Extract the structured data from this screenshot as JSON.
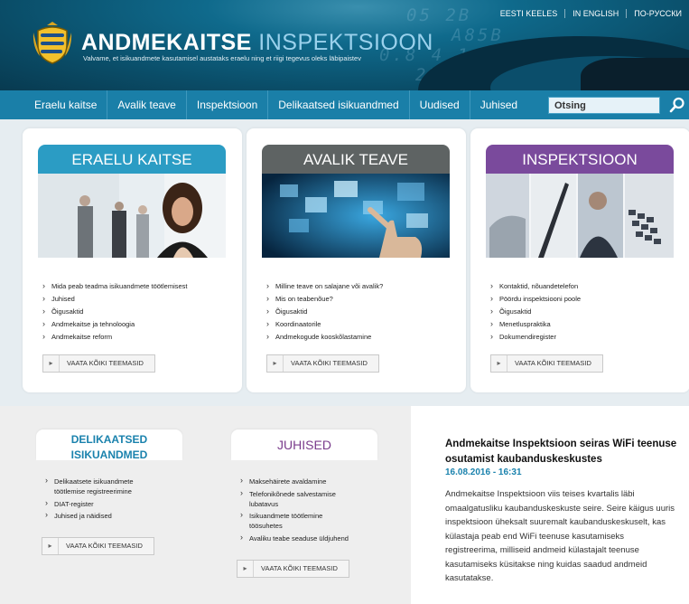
{
  "header": {
    "languages": [
      "EESTI KEELES",
      "IN ENGLISH",
      "ПО-РУССКИ"
    ],
    "brand_part1": "ANDMEKAITSE",
    "brand_part2": "INSPEKTSIOON",
    "tagline": "Valvame, et isikuandmete kasutamisel austataks eraelu ning et riigi tegevus oleks läbipaistev",
    "bg_digits": [
      "05 2B",
      "A85B",
      "0.8 4 1",
      "25BE7"
    ]
  },
  "nav": {
    "items": [
      "Eraelu kaitse",
      "Avalik teave",
      "Inspektsioon",
      "Delikaatsed isikuandmed",
      "Uudised",
      "Juhised"
    ],
    "search_value": "Otsing",
    "search_icon": "search-icon"
  },
  "cards": [
    {
      "title": "ERAELU KAITSE",
      "color": "#2b9cc4",
      "items": [
        "Mida peab teadma isikuandmete töötlemisest",
        "Juhised",
        "Õigusaktid",
        "Andmekaitse ja tehnoloogia",
        "Andmekaitse reform"
      ],
      "button": "VAATA KÕIKI TEEMASID"
    },
    {
      "title": "AVALIK TEAVE",
      "color": "#5e6363",
      "items": [
        "Milline teave on salajane või avalik?",
        "Mis on teabenõue?",
        "Õigusaktid",
        "Koordinaatorile",
        "Andmekogude kooskõlastamine"
      ],
      "button": "VAATA KÕIKI TEEMASID"
    },
    {
      "title": "INSPEKTSIOON",
      "color": "#7a4a9c",
      "items": [
        "Kontaktid, nõuandetelefon",
        "Pöördu inspektsiooni poole",
        "Õigusaktid",
        "Menetluspraktika",
        "Dokumendiregister"
      ],
      "button": "VAATA KÕIKI TEEMASID"
    }
  ],
  "delikaatsed": {
    "title_line1": "DELIKAATSED",
    "title_line2": "ISIKUANDMED",
    "items": [
      "Delikaatsete isikuandmete töötlemise registreerimine",
      "DIAT-register",
      "Juhised ja näidised"
    ],
    "button": "VAATA KÕIKI TEEMASID"
  },
  "juhised": {
    "title": "JUHISED",
    "items": [
      "Maksehäirete avaldamine",
      "Telefonikõnede salvestamise lubatavus",
      "Isikuandmete töötlemine töösuhetes",
      "Avaliku teabe seaduse üldjuhend"
    ],
    "button": "VAATA KÕIKI TEEMASID"
  },
  "news": {
    "title": "Andmekaitse Inspektsioon seiras WiFi teenuse osutamist kaubanduskeskustes",
    "date": "16.08.2016 - 16:31",
    "body": "Andmekaitse Inspektsioon viis teises kvartalis läbi omaalgatusliku kaubanduskeskuste seire. Seire käigus uuris inspektsioon üheksalt suuremalt kaubanduskeskuselt, kas külastaja peab end WiFi teenuse kasutamiseks registreerima, milliseid andmeid külastajalt teenuse kasutamiseks küsitakse ning kuidas saadud andmeid kasutatakse."
  }
}
